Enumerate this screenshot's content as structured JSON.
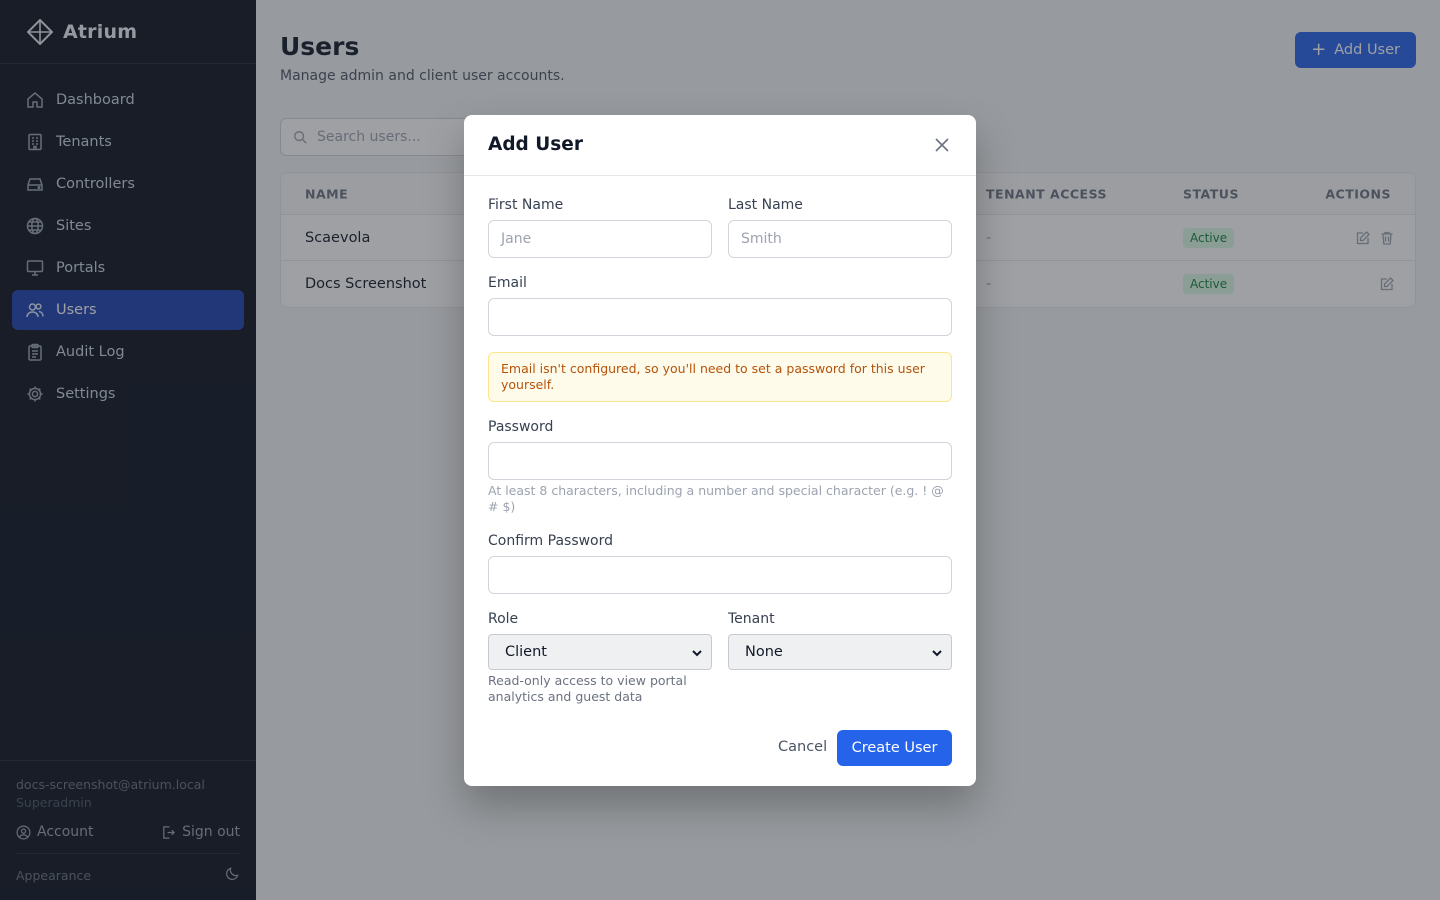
{
  "brand": {
    "name": "Atrium"
  },
  "sidebar": {
    "items": [
      {
        "label": "Dashboard",
        "icon": "home-icon"
      },
      {
        "label": "Tenants",
        "icon": "building-icon"
      },
      {
        "label": "Controllers",
        "icon": "hard-drive-icon"
      },
      {
        "label": "Sites",
        "icon": "globe-icon"
      },
      {
        "label": "Portals",
        "icon": "monitor-icon"
      },
      {
        "label": "Users",
        "icon": "users-icon",
        "active": true
      },
      {
        "label": "Audit Log",
        "icon": "clipboard-icon"
      },
      {
        "label": "Settings",
        "icon": "gear-icon"
      }
    ],
    "footer": {
      "email": "docs-screenshot@atrium.local",
      "role": "Superadmin",
      "account_label": "Account",
      "signout_label": "Sign out",
      "appearance_label": "Appearance"
    }
  },
  "page": {
    "title": "Users",
    "subtitle": "Manage admin and client user accounts.",
    "add_button": "Add User",
    "search_placeholder": "Search users...",
    "table": {
      "headers": {
        "name": "NAME",
        "tenant_access": "TENANT ACCESS",
        "status": "STATUS",
        "actions": "ACTIONS"
      },
      "rows": [
        {
          "name": "Scaevola",
          "tenant_access": "-",
          "status": "Active"
        },
        {
          "name": "Docs Screenshot",
          "tenant_access": "-",
          "status": "Active"
        }
      ]
    }
  },
  "modal": {
    "title": "Add User",
    "first_name_label": "First Name",
    "first_name_placeholder": "Jane",
    "last_name_label": "Last Name",
    "last_name_placeholder": "Smith",
    "email_label": "Email",
    "notice": "Email isn't configured, so you'll need to set a password for this user yourself.",
    "password_label": "Password",
    "password_hint": "At least 8 characters, including a number and special character (e.g. ! @ # $)",
    "confirm_label": "Confirm Password",
    "role_label": "Role",
    "role_value": "Client",
    "role_hint": "Read-only access to view portal analytics and guest data",
    "tenant_label": "Tenant",
    "tenant_value": "None",
    "cancel_label": "Cancel",
    "create_label": "Create User"
  },
  "colors": {
    "accent": "#2563eb",
    "sidebar_bg": "#0b1220",
    "active_nav": "#1e40af",
    "notice_text": "#b45309"
  }
}
